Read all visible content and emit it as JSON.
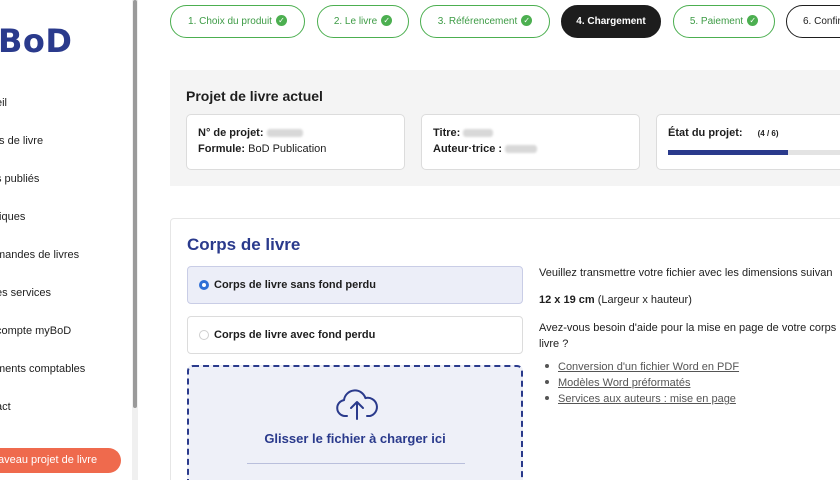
{
  "sidebar": {
    "logo": "BoD",
    "items": [
      {
        "label": "eil"
      },
      {
        "label": "ts de livre"
      },
      {
        "label": "s publiés"
      },
      {
        "label": "tiques"
      },
      {
        "label": "mandes de livres"
      },
      {
        "label": "es services"
      },
      {
        "label": "compte myBoD"
      },
      {
        "label": "ments comptables"
      },
      {
        "label": "act"
      }
    ],
    "new_project_label": "aveau projet de livre"
  },
  "steps": [
    {
      "label": "1. Choix du produit",
      "state": "done"
    },
    {
      "label": "2. Le livre",
      "state": "done"
    },
    {
      "label": "3. Référencement",
      "state": "done"
    },
    {
      "label": "4. Chargement",
      "state": "active"
    },
    {
      "label": "5. Paiement",
      "state": "done"
    },
    {
      "label": "6. Confir",
      "state": "pending"
    }
  ],
  "project": {
    "heading": "Projet de livre actuel",
    "project_no_label": "N° de projet:",
    "formula_label": "Formule:",
    "formula_value": "BoD Publication",
    "title_label": "Titre:",
    "author_label": "Auteur·trice :",
    "state_label": "État du projet:",
    "state_value": "(4 / 6)",
    "progress_fraction": 0.667
  },
  "content": {
    "title": "Corps de livre",
    "option_no_bleed": "Corps de livre sans fond perdu",
    "option_bleed": "Corps de livre avec fond perdu",
    "drop_text": "Glisser le fichier à charger ici",
    "info_line1": "Veuillez transmettre votre fichier avec les dimensions suivan",
    "dimensions_value": "12 x 19 cm",
    "dimensions_note": "(Largeur x hauteur)",
    "help_question": "Avez-vous besoin d'aide pour la mise en page de votre corps livre ?",
    "help_links": [
      "Conversion d'un fichier Word en PDF",
      "Modèles Word préformatés",
      "Services aux auteurs : mise en page"
    ]
  },
  "colors": {
    "brand_blue": "#2a3a8c",
    "success_green": "#4caf50",
    "accent_orange": "#ef6a4d"
  }
}
